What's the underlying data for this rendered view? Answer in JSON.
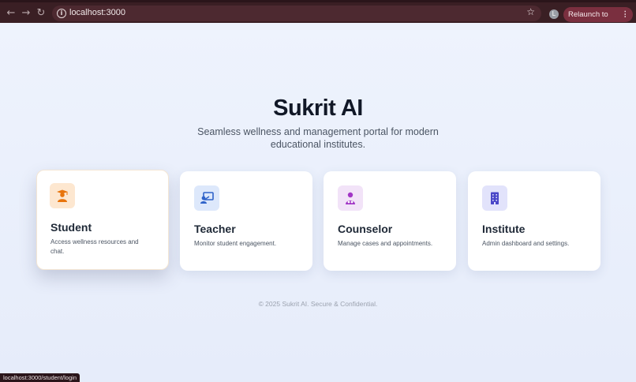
{
  "browser": {
    "url": "localhost:3000",
    "relaunch_label": "Relaunch to update",
    "profile_initial": "L",
    "status_url": "localhost:3000/student/login"
  },
  "hero": {
    "title": "Sukrit AI",
    "subtitle": "Seamless wellness and management portal for modern educational institutes."
  },
  "cards": [
    {
      "title": "Student",
      "description": "Access wellness resources and chat.",
      "icon": "graduation-student-icon",
      "accent": "#e8740c",
      "icon_bg": "#fde7d0"
    },
    {
      "title": "Teacher",
      "description": "Monitor student engagement.",
      "icon": "teacher-board-icon",
      "accent": "#2f63c9",
      "icon_bg": "#dde8fb"
    },
    {
      "title": "Counselor",
      "description": "Manage cases and appointments.",
      "icon": "counselor-icon",
      "accent": "#a236c6",
      "icon_bg": "#f2e3f8"
    },
    {
      "title": "Institute",
      "description": "Admin dashboard and settings.",
      "icon": "building-icon",
      "accent": "#4946c8",
      "icon_bg": "#e2e3fb"
    }
  ],
  "footer": {
    "text": "© 2025 Sukrit AI. Secure & Confidential."
  }
}
